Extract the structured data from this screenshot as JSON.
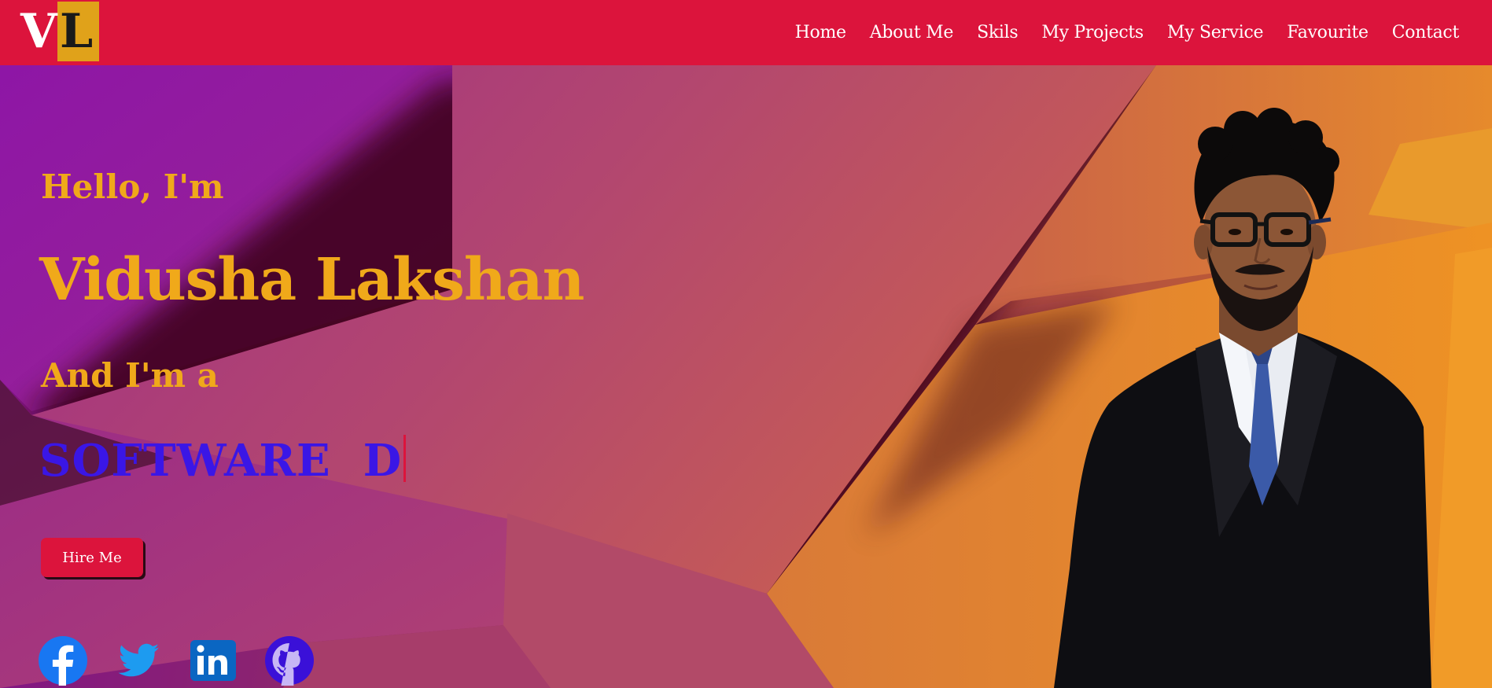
{
  "header": {
    "logo": {
      "letter_1": "V",
      "letter_2": "L"
    },
    "nav": [
      {
        "label": "Home"
      },
      {
        "label": "About Me"
      },
      {
        "label": "Skils"
      },
      {
        "label": "My Projects"
      },
      {
        "label": "My Service"
      },
      {
        "label": "Favourite"
      },
      {
        "label": "Contact"
      }
    ]
  },
  "hero": {
    "greeting": "Hello, I'm",
    "name": "Vidusha Lakshan",
    "subtitle": "And I'm a",
    "role_typed": "SOFTWARE  D",
    "hire_button": "Hire Me"
  },
  "social": [
    {
      "name": "facebook-icon"
    },
    {
      "name": "twitter-icon"
    },
    {
      "name": "linkedin-icon"
    },
    {
      "name": "github-icon"
    }
  ],
  "colors": {
    "header_bg": "#dc143c",
    "accent_gold": "#f0a91a",
    "role_blue": "#3a16e6",
    "button_bg": "#dc143c"
  }
}
